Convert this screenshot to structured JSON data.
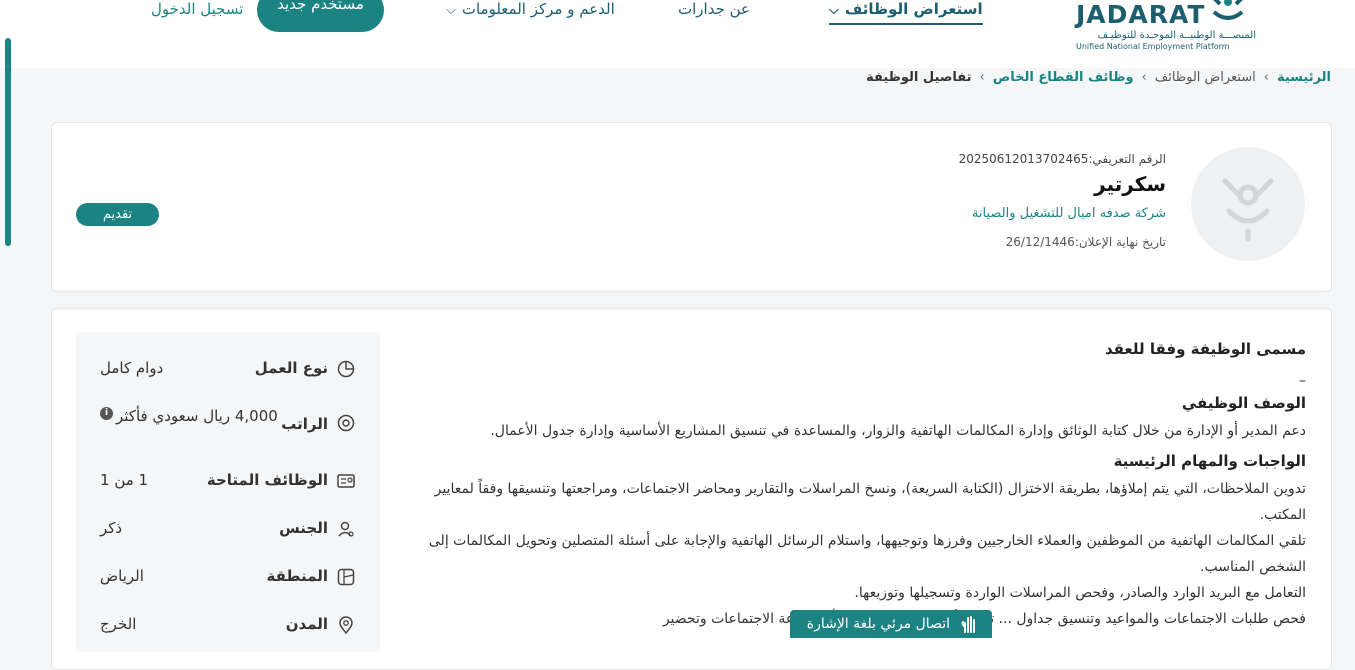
{
  "header": {
    "logo_word": "JADARAT",
    "logo_ar": "المنصـــة الوطنيــة الموحـدة للتوظيـف",
    "logo_en": "Unified National Employment Platform",
    "nav": [
      {
        "label": "استعراض الوظائف",
        "active": true,
        "dropdown": true
      },
      {
        "label": "عن جدارات",
        "active": false,
        "dropdown": false
      },
      {
        "label": "الدعم و مركز المعلومات",
        "active": false,
        "dropdown": true
      }
    ],
    "new_user_label": "مستخدم جديد",
    "login_label": "تسجيل الدخول"
  },
  "breadcrumb": {
    "home": "الرئيسية",
    "jobs": "استعراض الوظائف",
    "private": "وظائف القطاع الخاص",
    "current": "تفاصيل الوظيفة",
    "separator": "›"
  },
  "job": {
    "id_label": "الرقم التعريفي:",
    "id_value": "20250612013702465",
    "title": "سكرتير",
    "company": "شركة صدفه اميال للتشغيل والصيانة",
    "deadline_label": "تاريخ نهاية الإعلان:",
    "deadline_value": "26/12/1446",
    "apply_label": "تقديم"
  },
  "details": [
    {
      "icon": "pie-chart-icon",
      "label": "نوع العمل",
      "value": "دوام كامل"
    },
    {
      "icon": "salary-icon",
      "label": "الراتب",
      "value": "4,000 ريال سعودي فأكثر",
      "has_info": true
    },
    {
      "icon": "id-card-icon",
      "label": "الوظائف المتاحة",
      "value": "1 من 1"
    },
    {
      "icon": "gender-icon",
      "label": "الجنس",
      "value": "ذكر"
    },
    {
      "icon": "map-icon",
      "label": "المنطقة",
      "value": "الرياض"
    },
    {
      "icon": "location-pin-icon",
      "label": "المدن",
      "value": "الخرج"
    }
  ],
  "content": {
    "contract_title_heading": "مسمى الوظيفة وفقا للعقد",
    "contract_title_value": "–",
    "description_heading": "الوصف الوظيفي",
    "description_text": "دعم المدير أو الإدارة من خلال كتابة الوثائق وإدارة المكالمات الهاتفية والزوار، والمساعدة في تنسيق المشاريع الأساسية وإدارة جدول الأعمال.",
    "duties_heading": "الواجبات والمهام الرئيسية",
    "duties": [
      "تدوين الملاحظات، التي يتم إملاؤها، بطريقة الاختزال (الكتابة السريعة)، ونسخ المراسلات والتقارير ومحاضر الاجتماعات، ومراجعتها وتنسيقها وفقاً لمعايير المكتب.",
      "تلقي المكالمات الهاتفية من الموظفين والعملاء الخارجيين وفرزها وتوجيهها، واستلام الرسائل الهاتفية والإجابة على أسئلة المتصلين وتحويل المكالمات إلى الشخص المناسب.",
      "التعامل مع البريد الوارد والصادر، وفحص المراسلات الواردة وتسجيلها وتوزيعها.",
      "فحص طلبات الاجتماعات والمواعيد وتنسيق جداول ... تحديد أوقات الاجتماعات، وتأمين قاعة الاجتماعات وتحضير"
    ]
  },
  "accessibility": {
    "sign_language_label": "اتصال مرئي بلغة الإشارة"
  }
}
